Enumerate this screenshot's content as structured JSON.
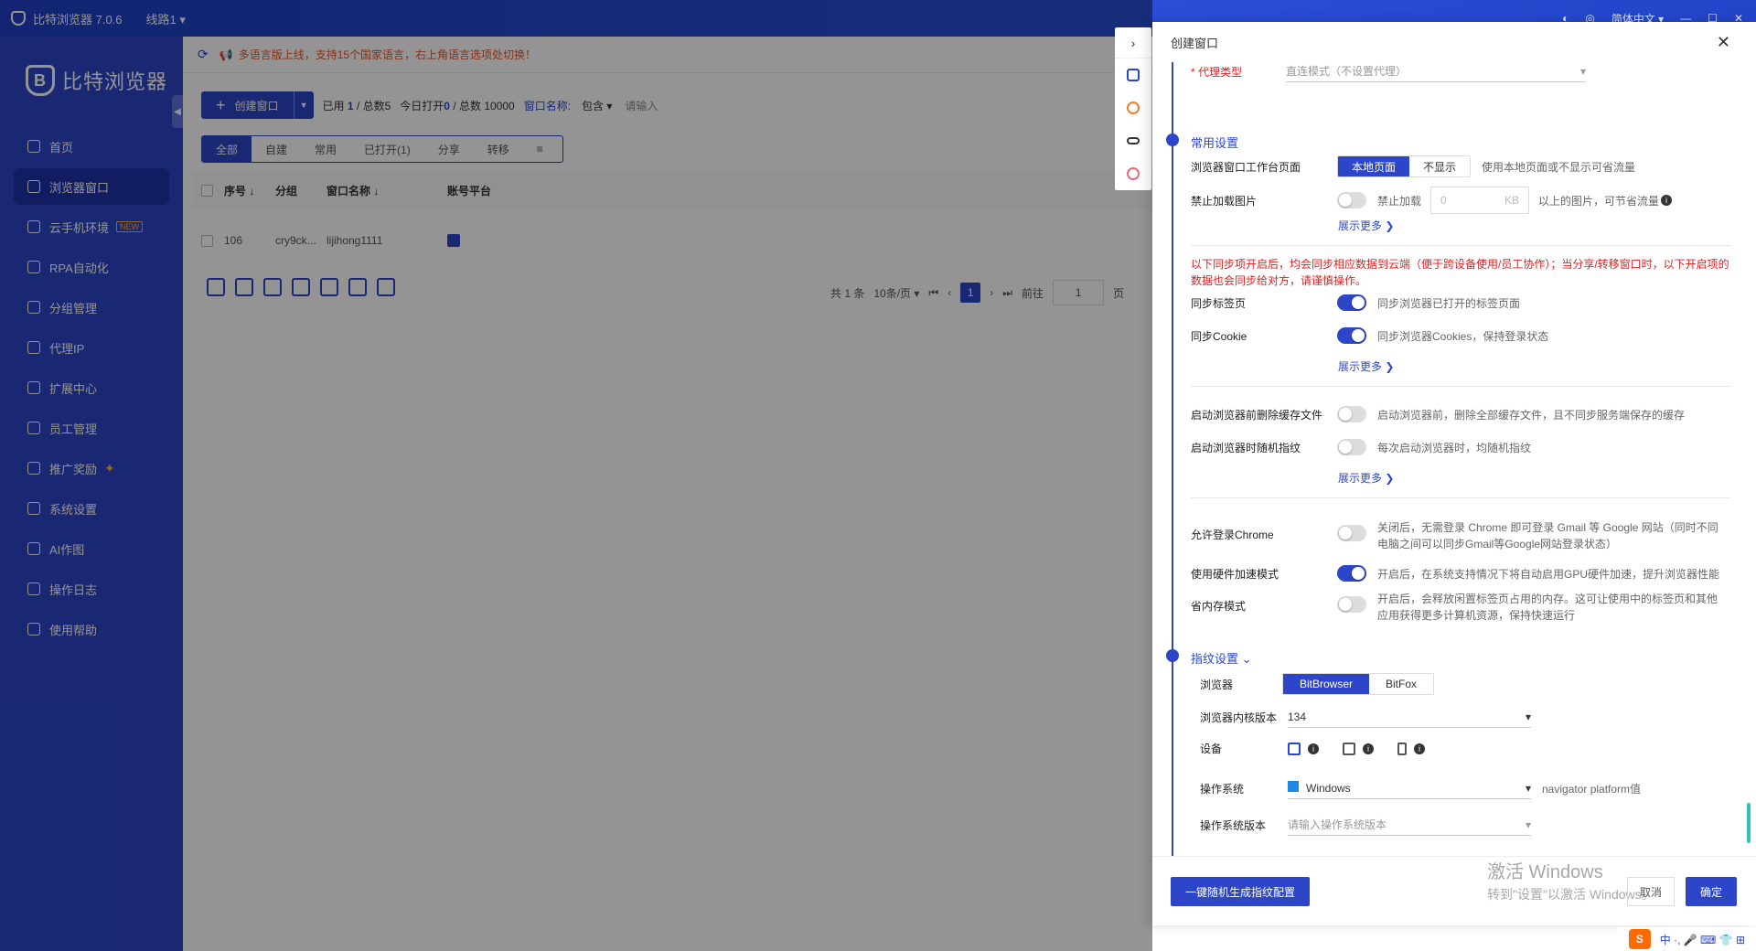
{
  "titlebar": {
    "app_name": "比特浏览器 7.0.6",
    "line": "线路1 ▾",
    "language": "简体中文 ▾"
  },
  "sidebar": {
    "brand": "比特浏览器",
    "items": [
      {
        "label": "首页",
        "icon": "home-icon"
      },
      {
        "label": "浏览器窗口",
        "icon": "grid-icon"
      },
      {
        "label": "云手机环境",
        "icon": "cloud-icon",
        "badge": "NEW"
      },
      {
        "label": "RPA自动化",
        "icon": "robot-icon"
      },
      {
        "label": "分组管理",
        "icon": "layers-icon"
      },
      {
        "label": "代理IP",
        "icon": "location-icon"
      },
      {
        "label": "扩展中心",
        "icon": "puzzle-icon"
      },
      {
        "label": "员工管理",
        "icon": "users-icon"
      },
      {
        "label": "推广奖励",
        "icon": "gift-icon"
      },
      {
        "label": "系统设置",
        "icon": "gear-icon"
      },
      {
        "label": "AI作图",
        "icon": "ai-icon"
      },
      {
        "label": "操作日志",
        "icon": "log-icon"
      },
      {
        "label": "使用帮助",
        "icon": "help-icon"
      }
    ]
  },
  "notice": "多语言版上线，支持15个国家语言，右上角语言选项处切换！",
  "toolbar": {
    "create_label": "创建窗口",
    "used_prefix": "已用",
    "used": "1",
    "total": "/ 总数5",
    "today_prefix": "今日打开",
    "today": "0",
    "today_total": "/ 总数 10000",
    "window_name_label": "窗口名称:",
    "match_label": "包含 ▾",
    "search_placeholder": "请输入"
  },
  "tabs": [
    "全部",
    "自建",
    "常用",
    "已打开(1)",
    "分享",
    "转移"
  ],
  "table": {
    "headers": [
      "序号 ↓",
      "分组",
      "窗口名称 ↓",
      "账号平台"
    ],
    "rows": [
      {
        "id": "106",
        "group": "cry9ck...",
        "name": "lijihong1111"
      }
    ]
  },
  "pager": {
    "total": "共 1 条",
    "size": "10条/页 ▾",
    "page": "1",
    "goto_label": "前往",
    "goto_value": "1",
    "page_suffix": "页"
  },
  "drawer": {
    "title": "创建窗口",
    "proxy_label": "* 代理类型",
    "proxy_value": "直连模式（不设置代理）",
    "common_section": "常用设置",
    "workbench_label": "浏览器窗口工作台页面",
    "workbench_options": [
      "本地页面",
      "不显示"
    ],
    "workbench_hint": "使用本地页面或不显示可省流量",
    "img_label": "禁止加载图片",
    "img_switch": "禁止加载",
    "img_kb_placeholder": "0",
    "img_kb_unit": "KB",
    "img_hint": "以上的图片，可节省流量",
    "show_more": "展示更多 ❯",
    "sync_warning": "以下同步项开启后，均会同步相应数据到云端（便于跨设备使用/员工协作）；当分享/转移窗口时，以下开启项的数据也会同步给对方，请谨慎操作。",
    "sync_tabs_label": "同步标签页",
    "sync_tabs_hint": "同步浏览器已打开的标签页面",
    "sync_cookie_label": "同步Cookie",
    "sync_cookie_hint": "同步浏览器Cookies，保持登录状态",
    "clear_cache_label": "启动浏览器前删除缓存文件",
    "clear_cache_hint": "启动浏览器前，删除全部缓存文件，且不同步服务端保存的缓存",
    "random_fp_label": "启动浏览器时随机指纹",
    "random_fp_hint": "每次启动浏览器时，均随机指纹",
    "chrome_login_label": "允许登录Chrome",
    "chrome_login_hint": "关闭后，无需登录 Chrome 即可登录 Gmail 等 Google 网站（同时不同电脑之间可以同步Gmail等Google网站登录状态）",
    "hw_accel_label": "使用硬件加速模式",
    "hw_accel_hint": "开启后，在系统支持情况下将自动启用GPU硬件加速，提升浏览器性能",
    "mem_label": "省内存模式",
    "mem_hint": "开启后，会释放闲置标签页占用的内存。这可让使用中的标签页和其他应用获得更多计算机资源，保持快速运行",
    "fp_section": "指纹设置",
    "browser_label": "浏览器",
    "browser_options": [
      "BitBrowser",
      "BitFox"
    ],
    "kernel_label": "浏览器内核版本",
    "kernel_value": "134",
    "device_label": "设备",
    "os_label": "操作系统",
    "os_value": "Windows",
    "os_hint": "navigator platform值",
    "os_version_label": "操作系统版本",
    "os_version_placeholder": "请输入操作系统版本",
    "gen_btn": "一键随机生成指纹配置",
    "cancel_btn": "取消",
    "ok_btn": "确定",
    "watermark_1": "激活 Windows",
    "watermark_2": "转到\"设置\"以激活 Windows。"
  },
  "tray": "中 ·, 🎤 ⌨ 👕 ⊞",
  "colors": {
    "primary": "#2d46c9",
    "sidebar": "#2d46c9",
    "warning": "#e02020",
    "notice": "#e5532a"
  }
}
